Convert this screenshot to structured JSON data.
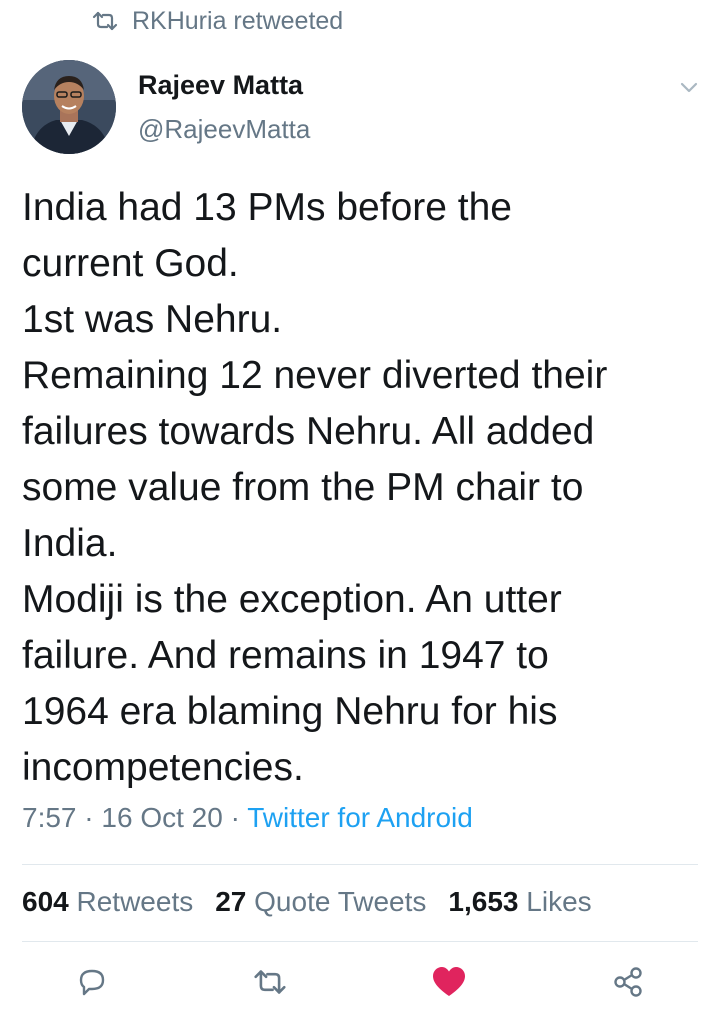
{
  "retweet_banner": {
    "text": "RKHuria retweeted",
    "icon": "retweet-icon"
  },
  "author": {
    "display_name": "Rajeev Matta",
    "handle": "@RajeevMatta",
    "avatar": "avatar-photo"
  },
  "tweet": {
    "lines": [
      "India had 13 PMs before the",
      "current God.",
      "1st was Nehru.",
      "Remaining 12 never diverted their",
      "failures towards Nehru. All added",
      "some value from the PM chair to",
      "India.",
      "Modiji is the exception. An utter",
      "failure. And remains in 1947 to",
      "1964 era blaming Nehru for his",
      "incompetencies."
    ],
    "time": "7:57",
    "date": "16 Oct 20",
    "source": "Twitter for Android",
    "separator": "·"
  },
  "stats": {
    "retweets": {
      "count": "604",
      "label": "Retweets"
    },
    "quotes": {
      "count": "27",
      "label": "Quote Tweets"
    },
    "likes": {
      "count": "1,653",
      "label": "Likes"
    }
  },
  "actions": [
    "reply-icon",
    "retweet-icon",
    "like-icon",
    "share-icon"
  ],
  "colors": {
    "text": "#14171a",
    "secondary": "#657786",
    "link": "#1da1f2",
    "like": "#e0245e",
    "divider": "#e1e8ed"
  }
}
